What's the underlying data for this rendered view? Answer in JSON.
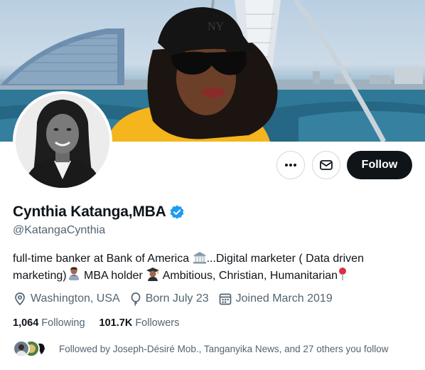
{
  "banner": {
    "icon": "banner-photo"
  },
  "avatar": {
    "icon": "profile-photo"
  },
  "actions": {
    "more_icon": "more-icon",
    "message_icon": "mail-icon",
    "follow_label": "Follow"
  },
  "profile": {
    "name": "Cynthia Katanga,MBA",
    "verified_icon": "verified-badge-icon",
    "handle": "@KatangaCynthia",
    "bio": {
      "part1": "full-time banker at Bank of America ",
      "part2": "...Digital marketer ( Data driven marketing)",
      "part3": " MBA holder ",
      "part4": " Ambitious, Christian, Humanitarian"
    },
    "location": "Washington, USA",
    "born": "Born July 23",
    "joined": "Joined March 2019"
  },
  "stats": {
    "following_count": "1,064",
    "following_label": "Following",
    "followers_count": "101.7K",
    "followers_label": "Followers"
  },
  "followed_by": {
    "text": "Followed by Joseph-Désiré Mob., Tanganyika News, and 27 others you follow"
  },
  "colors": {
    "accent": "#1d9bf0",
    "text_primary": "#0f1419",
    "text_secondary": "#536471",
    "border": "#cfd9de"
  }
}
